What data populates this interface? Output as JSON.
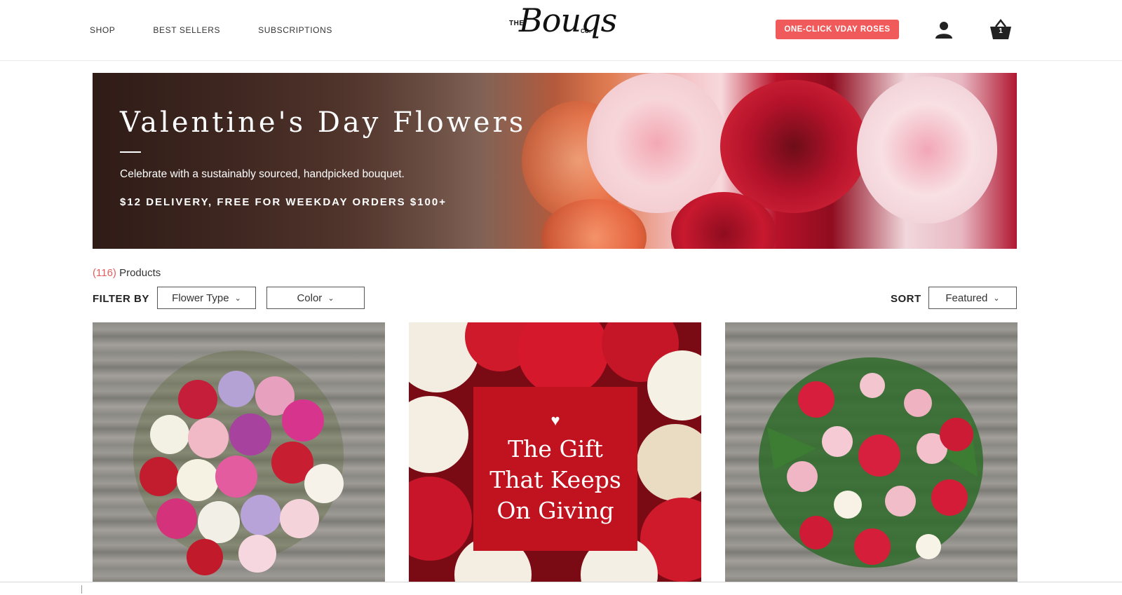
{
  "nav": {
    "items": [
      "SHOP",
      "BEST SELLERS",
      "SUBSCRIPTIONS"
    ]
  },
  "logo": {
    "the": "THE",
    "script": "Bouqs",
    "co": "CO."
  },
  "header": {
    "promo_label": "ONE-CLICK VDAY ROSES",
    "cart_count": "1",
    "account_icon": "user-icon",
    "cart_icon": "basket-icon"
  },
  "hero": {
    "title": "Valentine's Day Flowers",
    "subtitle": "Celebrate with a sustainably sourced, handpicked bouquet.",
    "delivery": "$12 DELIVERY, FREE FOR WEEKDAY ORDERS $100+"
  },
  "products": {
    "count": "(116)",
    "label": "Products",
    "filter_label": "FILTER BY",
    "filters": [
      "Flower Type",
      "Color"
    ],
    "sort_label": "SORT",
    "sort_value": "Featured"
  },
  "cards": [
    {
      "image": "mixed-roses-bouquet"
    },
    {
      "image": "gift-that-keeps-on-giving",
      "overlay_lines": [
        "The Gift",
        "That Keeps",
        "On Giving"
      ]
    },
    {
      "image": "roses-and-alstroemeria-bouquet"
    }
  ],
  "colors": {
    "accent": "#f05a5b",
    "count_red": "#e35d5e",
    "gift_red": "#c1121f"
  }
}
